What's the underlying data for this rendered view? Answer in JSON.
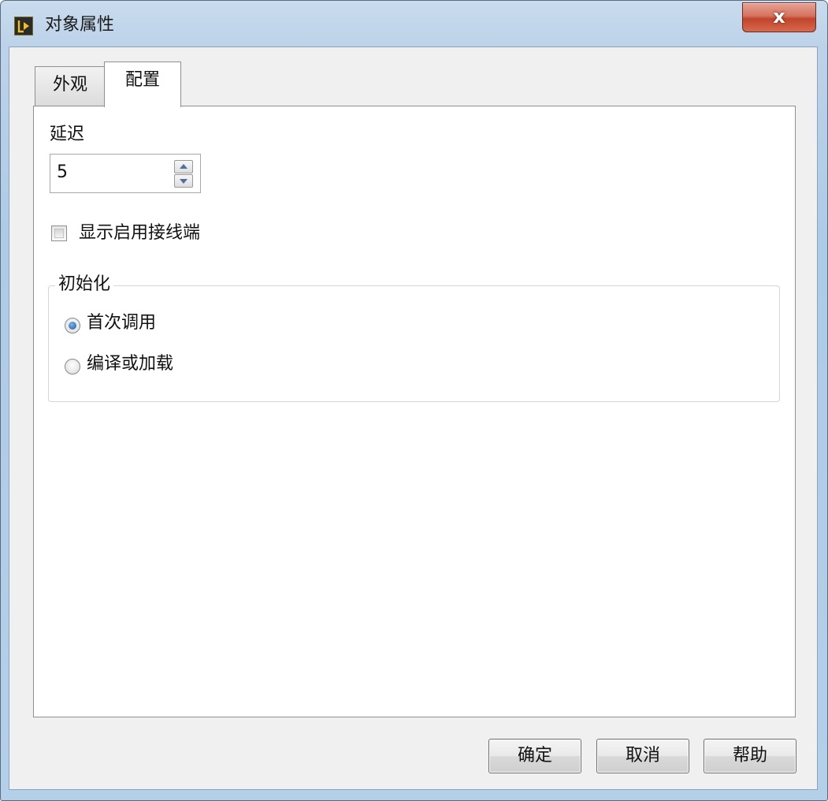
{
  "window": {
    "title": "对象属性",
    "close_label": "x"
  },
  "tabs": [
    {
      "label": "外观",
      "active": false
    },
    {
      "label": "配置",
      "active": true
    }
  ],
  "config": {
    "delay_label": "延迟",
    "delay_value": "5",
    "show_enable_terminal_label": "显示启用接线端",
    "show_enable_terminal_checked": false,
    "init_group_label": "初始化",
    "init_options": [
      {
        "label": "首次调用",
        "selected": true
      },
      {
        "label": "编译或加载",
        "selected": false
      }
    ]
  },
  "buttons": {
    "ok": "确定",
    "cancel": "取消",
    "help": "帮助"
  },
  "colors": {
    "title_bar": "#bcd2e8",
    "close_button": "#c2442c",
    "radio_selected": "#1a56a0",
    "dialog_background": "#f0f0f0"
  }
}
